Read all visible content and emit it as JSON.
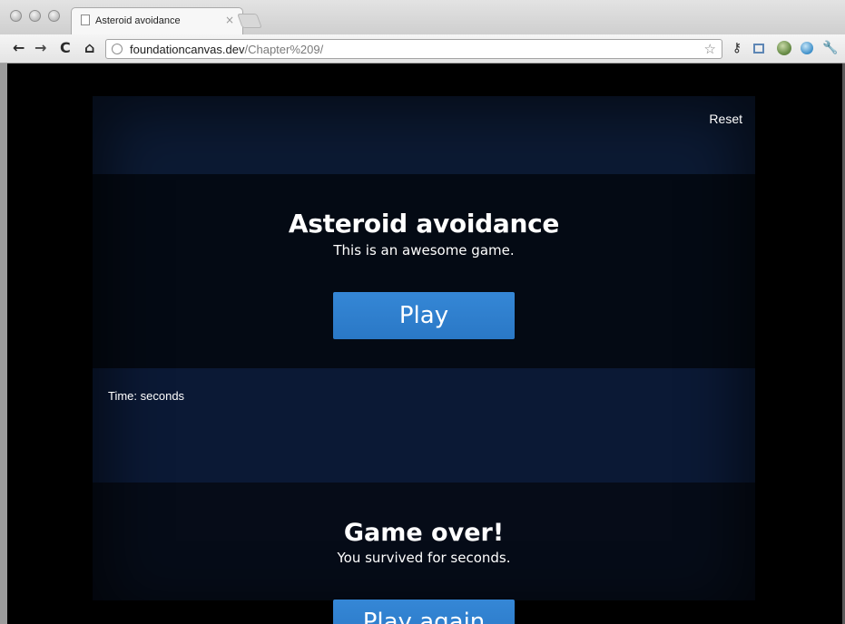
{
  "browser": {
    "tab_title": "Asteroid avoidance",
    "tab_close": "×",
    "url_host": "foundationcanvas.dev",
    "url_path": "/Chapter%209/",
    "icons": {
      "back": "back-arrow-icon",
      "forward": "forward-arrow-icon",
      "reload": "reload-icon",
      "home": "home-icon",
      "site": "globe-icon",
      "bookmark": "star-icon",
      "extensions": [
        "key-icon",
        "crop-icon",
        "globe-extension-icon",
        "cloud-icon",
        "wrench-icon"
      ]
    },
    "glyphs": {
      "back": "←",
      "forward": "→",
      "reload": "C",
      "home": "⌂",
      "star": "☆",
      "key": "⚷",
      "wrench": "🔧"
    }
  },
  "game": {
    "reset_label": "Reset",
    "intro_title": "Asteroid avoidance",
    "intro_subtitle": "This is an awesome game.",
    "play_label": "Play",
    "timer_label": "Time: seconds",
    "game_over_title": "Game over!",
    "game_over_subtitle": "You survived for seconds.",
    "play_again_label": "Play again"
  },
  "colors": {
    "button": "#2a78c6",
    "panel_dark": "#040a14",
    "panel_blue": "#0b1935",
    "text": "#ffffff"
  }
}
